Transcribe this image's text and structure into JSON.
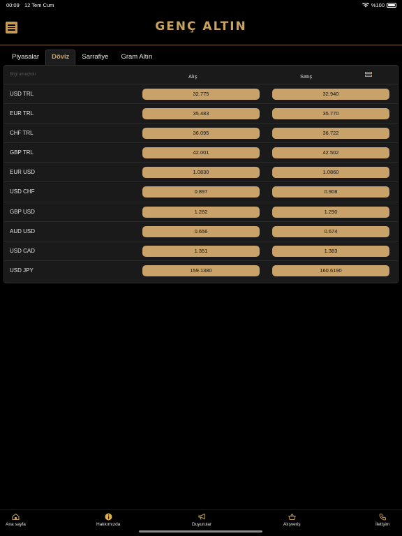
{
  "status": {
    "time": "00:09",
    "date": "12 Tem Cum",
    "battery": "%100"
  },
  "header": {
    "logo": "GENÇ ALTIN"
  },
  "tabs": [
    {
      "label": "Piyasalar",
      "active": false
    },
    {
      "label": "Döviz",
      "active": true
    },
    {
      "label": "Sarrafiye",
      "active": false
    },
    {
      "label": "Gram Altın",
      "active": false
    }
  ],
  "table": {
    "disclaimer": "Bilgi amaçlıdır",
    "buy_label": "Alış",
    "sell_label": "Satış",
    "rows": [
      {
        "name": "USD TRL",
        "buy": "32.775",
        "sell": "32.940"
      },
      {
        "name": "EUR TRL",
        "buy": "35.483",
        "sell": "35.770"
      },
      {
        "name": "CHF TRL",
        "buy": "36.095",
        "sell": "36.722"
      },
      {
        "name": "GBP TRL",
        "buy": "42.001",
        "sell": "42.502"
      },
      {
        "name": "EUR USD",
        "buy": "1.0830",
        "sell": "1.0860"
      },
      {
        "name": "USD CHF",
        "buy": "0.897",
        "sell": "0.908"
      },
      {
        "name": "GBP USD",
        "buy": "1.282",
        "sell": "1.290"
      },
      {
        "name": "AUD USD",
        "buy": "0.656",
        "sell": "0.674"
      },
      {
        "name": "USD CAD",
        "buy": "1.351",
        "sell": "1.383"
      },
      {
        "name": "USD JPY",
        "buy": "159.1380",
        "sell": "160.6190"
      }
    ]
  },
  "bottom_nav": [
    {
      "label": "Ana sayfa",
      "icon": "home-icon"
    },
    {
      "label": "Hakkımızda",
      "icon": "info-icon"
    },
    {
      "label": "Duyurular",
      "icon": "megaphone-icon"
    },
    {
      "label": "Alışveriş",
      "icon": "basket-icon"
    },
    {
      "label": "İletişim",
      "icon": "phone-icon"
    }
  ],
  "colors": {
    "accent": "#c9a35e",
    "pill": "#c9a26a",
    "background": "#000000",
    "card": "#1a1a1a"
  }
}
